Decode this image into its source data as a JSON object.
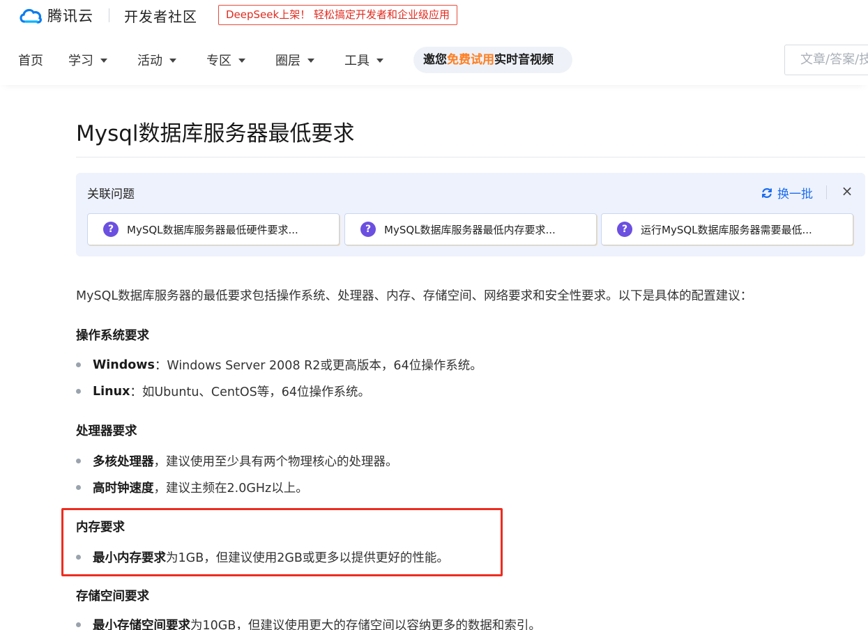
{
  "brand": {
    "logo_text": "腾讯云",
    "community": "开发者社区",
    "promo": "DeepSeek上架！ 轻松搞定开发者和企业级应用"
  },
  "nav": {
    "items": [
      "首页",
      "学习",
      "活动",
      "专区",
      "圈层",
      "工具"
    ],
    "pill_prefix": "邀您",
    "pill_highlight": "免费试用",
    "pill_suffix": "实时音视频",
    "search_placeholder": "文章/答案/技"
  },
  "article": {
    "title": "Mysql数据库服务器最低要求",
    "related": {
      "title": "关联问题",
      "refresh": "换一批",
      "close": "×",
      "questions": [
        "MySQL数据库服务器最低硬件要求...",
        "MySQL数据库服务器最低内存要求...",
        "运行MySQL数据库服务器需要最低..."
      ]
    },
    "intro": "MySQL数据库服务器的最低要求包括操作系统、处理器、内存、存储空间、网络要求和安全性要求。以下是具体的配置建议：",
    "sections": [
      {
        "heading": "操作系统要求",
        "items": [
          {
            "bold": "Windows",
            "text": "：Windows Server 2008 R2或更高版本，64位操作系统。"
          },
          {
            "bold": "Linux",
            "text": "：如Ubuntu、CentOS等，64位操作系统。"
          }
        ]
      },
      {
        "heading": "处理器要求",
        "items": [
          {
            "bold": "多核处理器",
            "text": "，建议使用至少具有两个物理核心的处理器。"
          },
          {
            "bold": "高时钟速度",
            "text": "，建议主频在2.0GHz以上。"
          }
        ]
      },
      {
        "heading": "内存要求",
        "items": [
          {
            "bold": "最小内存要求",
            "text": "为1GB，但建议使用2GB或更多以提供更好的性能。"
          }
        ]
      },
      {
        "heading": "存储空间要求",
        "items": [
          {
            "bold": "最小存储空间要求",
            "text": "为10GB，但建议使用更大的存储空间以容纳更多的数据和索引。"
          }
        ]
      }
    ]
  },
  "colors": {
    "accent_blue": "#1a6cf0",
    "promo_red": "#e02b1f",
    "highlight_red": "#ee2c1f",
    "pill_orange": "#ff7d1f"
  }
}
